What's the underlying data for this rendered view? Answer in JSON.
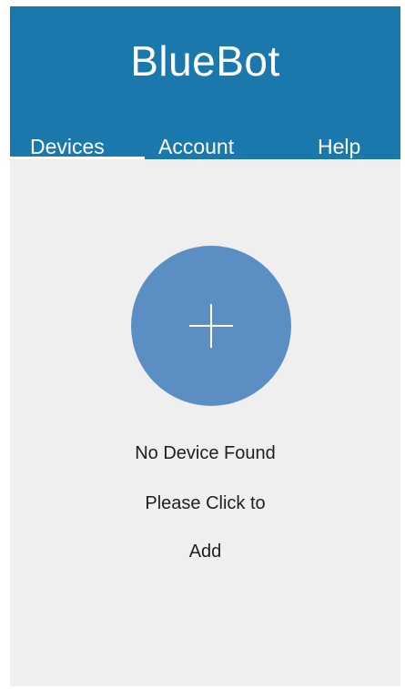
{
  "app": {
    "title": "BlueBot"
  },
  "tabs": [
    {
      "label": "Devices",
      "active": true
    },
    {
      "label": "Account",
      "active": false
    },
    {
      "label": "Help",
      "active": false
    }
  ],
  "empty_state": {
    "icon": "plus-icon",
    "line1": "No Device Found",
    "line2": "Please Click to",
    "line3": "Add"
  },
  "colors": {
    "header_bg": "#1a78ad",
    "add_button_bg": "#5b8fc3",
    "content_bg": "#efefef"
  }
}
